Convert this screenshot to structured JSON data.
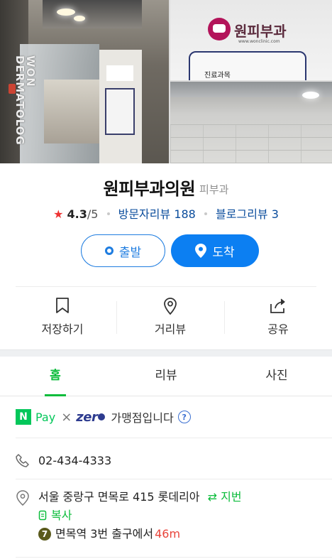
{
  "gallery": {
    "main_photo_door_text": "WON DERMATOLOG",
    "top_photo_logo_text": "원피부과",
    "top_photo_url_text": "www.wonclinic.com",
    "top_photo_frame_label": "진료과목"
  },
  "place": {
    "name": "원피부과의원",
    "category": "피부과"
  },
  "meta": {
    "star": "★",
    "rating": "4.3",
    "rating_max": "/5",
    "visitor_reviews_label": "방문자리뷰",
    "visitor_reviews_count": "188",
    "blog_reviews_label": "블로그리뷰",
    "blog_reviews_count": "3"
  },
  "actions": {
    "depart_label": "출발",
    "arrive_label": "도착"
  },
  "quick_actions": {
    "save_label": "저장하기",
    "street_view_label": "거리뷰",
    "share_label": "공유"
  },
  "tabs": [
    {
      "label": "홈",
      "active": true
    },
    {
      "label": "리뷰",
      "active": false
    },
    {
      "label": "사진",
      "active": false
    }
  ],
  "npay": {
    "n_logo": "N",
    "pay_text": "Pay",
    "times": "×",
    "zero_text": "zer",
    "member_text": "가맹점입니다",
    "help": "?"
  },
  "phone": "02-434-4333",
  "address": {
    "text": "서울 중랑구 면목로 415 롯데리아",
    "lot_toggle": "지번",
    "copy_label": "복사",
    "line_number": "7",
    "station_text": "면목역 3번 출구에서",
    "distance": "46m"
  },
  "colors": {
    "accent_blue": "#0c7ff2",
    "accent_green": "#0bbc3b",
    "star_red": "#e33333",
    "distance_red": "#e8443a"
  }
}
